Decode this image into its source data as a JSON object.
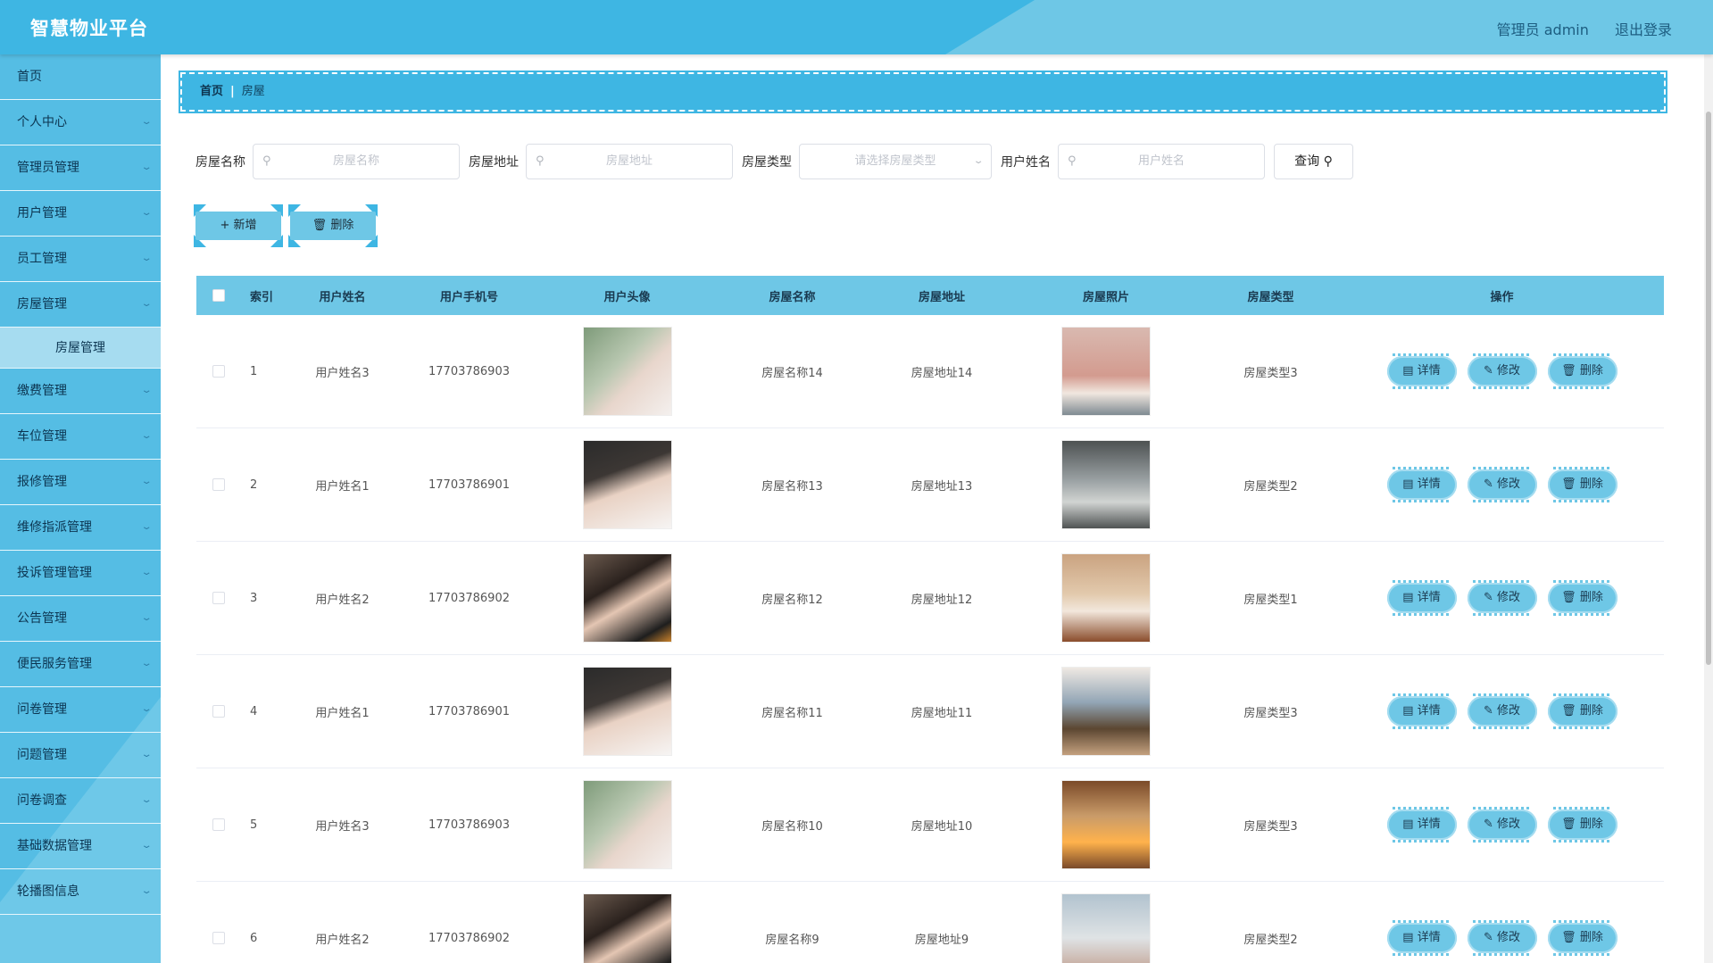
{
  "header": {
    "brand": "智慧物业平台",
    "user_label": "管理员 admin",
    "logout_label": "退出登录"
  },
  "sidebar": {
    "items": [
      {
        "label": "首页",
        "has_children": false
      },
      {
        "label": "个人中心",
        "has_children": true
      },
      {
        "label": "管理员管理",
        "has_children": true
      },
      {
        "label": "用户管理",
        "has_children": true
      },
      {
        "label": "员工管理",
        "has_children": true
      },
      {
        "label": "房屋管理",
        "has_children": true,
        "expanded": true
      },
      {
        "label": "缴费管理",
        "has_children": true
      },
      {
        "label": "车位管理",
        "has_children": true
      },
      {
        "label": "报修管理",
        "has_children": true
      },
      {
        "label": "维修指派管理",
        "has_children": true
      },
      {
        "label": "投诉管理管理",
        "has_children": true
      },
      {
        "label": "公告管理",
        "has_children": true
      },
      {
        "label": "便民服务管理",
        "has_children": true
      },
      {
        "label": "问卷管理",
        "has_children": true
      },
      {
        "label": "问题管理",
        "has_children": true
      },
      {
        "label": "问卷调查",
        "has_children": true
      },
      {
        "label": "基础数据管理",
        "has_children": true
      },
      {
        "label": "轮播图信息",
        "has_children": true
      }
    ],
    "submenu": {
      "label": "房屋管理"
    },
    "chevron_icon": "chevron-down-icon"
  },
  "breadcrumb": {
    "home": "首页",
    "separator": "|",
    "current": "房屋"
  },
  "search": {
    "house_name_label": "房屋名称",
    "house_name_placeholder": "房屋名称",
    "house_addr_label": "房屋地址",
    "house_addr_placeholder": "房屋地址",
    "house_type_label": "房屋类型",
    "house_type_placeholder": "请选择房屋类型",
    "user_name_label": "用户姓名",
    "user_name_placeholder": "用户姓名",
    "query_label": "查询",
    "search_icon": "search-icon"
  },
  "actions": {
    "add_label": "新增",
    "delete_label": "删除"
  },
  "table": {
    "columns": [
      "索引",
      "用户姓名",
      "用户手机号",
      "用户头像",
      "房屋名称",
      "房屋地址",
      "房屋照片",
      "房屋类型",
      "操作"
    ],
    "op_labels": {
      "detail": "详情",
      "edit": "修改",
      "delete": "删除"
    },
    "rows": [
      {
        "index": "1",
        "user_name": "用户姓名3",
        "phone": "17703786903",
        "house_name": "房屋名称14",
        "house_addr": "房屋地址14",
        "house_type": "房屋类型3"
      },
      {
        "index": "2",
        "user_name": "用户姓名1",
        "phone": "17703786901",
        "house_name": "房屋名称13",
        "house_addr": "房屋地址13",
        "house_type": "房屋类型2"
      },
      {
        "index": "3",
        "user_name": "用户姓名2",
        "phone": "17703786902",
        "house_name": "房屋名称12",
        "house_addr": "房屋地址12",
        "house_type": "房屋类型1"
      },
      {
        "index": "4",
        "user_name": "用户姓名1",
        "phone": "17703786901",
        "house_name": "房屋名称11",
        "house_addr": "房屋地址11",
        "house_type": "房屋类型3"
      },
      {
        "index": "5",
        "user_name": "用户姓名3",
        "phone": "17703786903",
        "house_name": "房屋名称10",
        "house_addr": "房屋地址10",
        "house_type": "房屋类型3"
      },
      {
        "index": "6",
        "user_name": "用户姓名2",
        "phone": "17703786902",
        "house_name": "房屋名称9",
        "house_addr": "房屋地址9",
        "house_type": "房屋类型2"
      }
    ]
  },
  "colors": {
    "header_bg": "#3eb6e3",
    "sidebar_bg": "#55bde4",
    "accent": "#6ec7e6"
  }
}
